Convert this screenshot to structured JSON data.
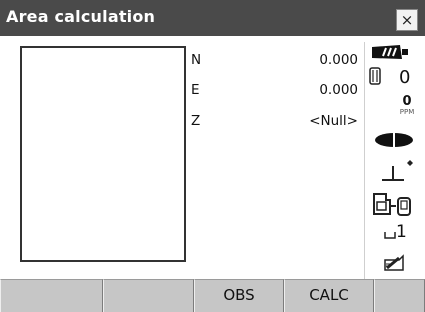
{
  "title": "Area calculation",
  "close_label": "×",
  "coords": [
    {
      "label": "N",
      "value": "0.000"
    },
    {
      "label": "E",
      "value": "0.000"
    },
    {
      "label": "Z",
      "value": "<Null>"
    }
  ],
  "status": {
    "count_value": "0",
    "ppm_value": "0",
    "ppm_label": "PPM",
    "memory_value": "1"
  },
  "softkeys": [
    "",
    "",
    "OBS",
    "CALC",
    ""
  ],
  "colors": {
    "titlebar": "#4a4a4a",
    "softkey": "#c6c6c6"
  },
  "icons": [
    "battery-icon",
    "target-prism-icon",
    "ppm-indicator",
    "laser-beam-icon",
    "tilt-compensation-icon",
    "instrument-bluetooth-icon",
    "memory-interface-icon",
    "input-mode-pen-icon"
  ]
}
